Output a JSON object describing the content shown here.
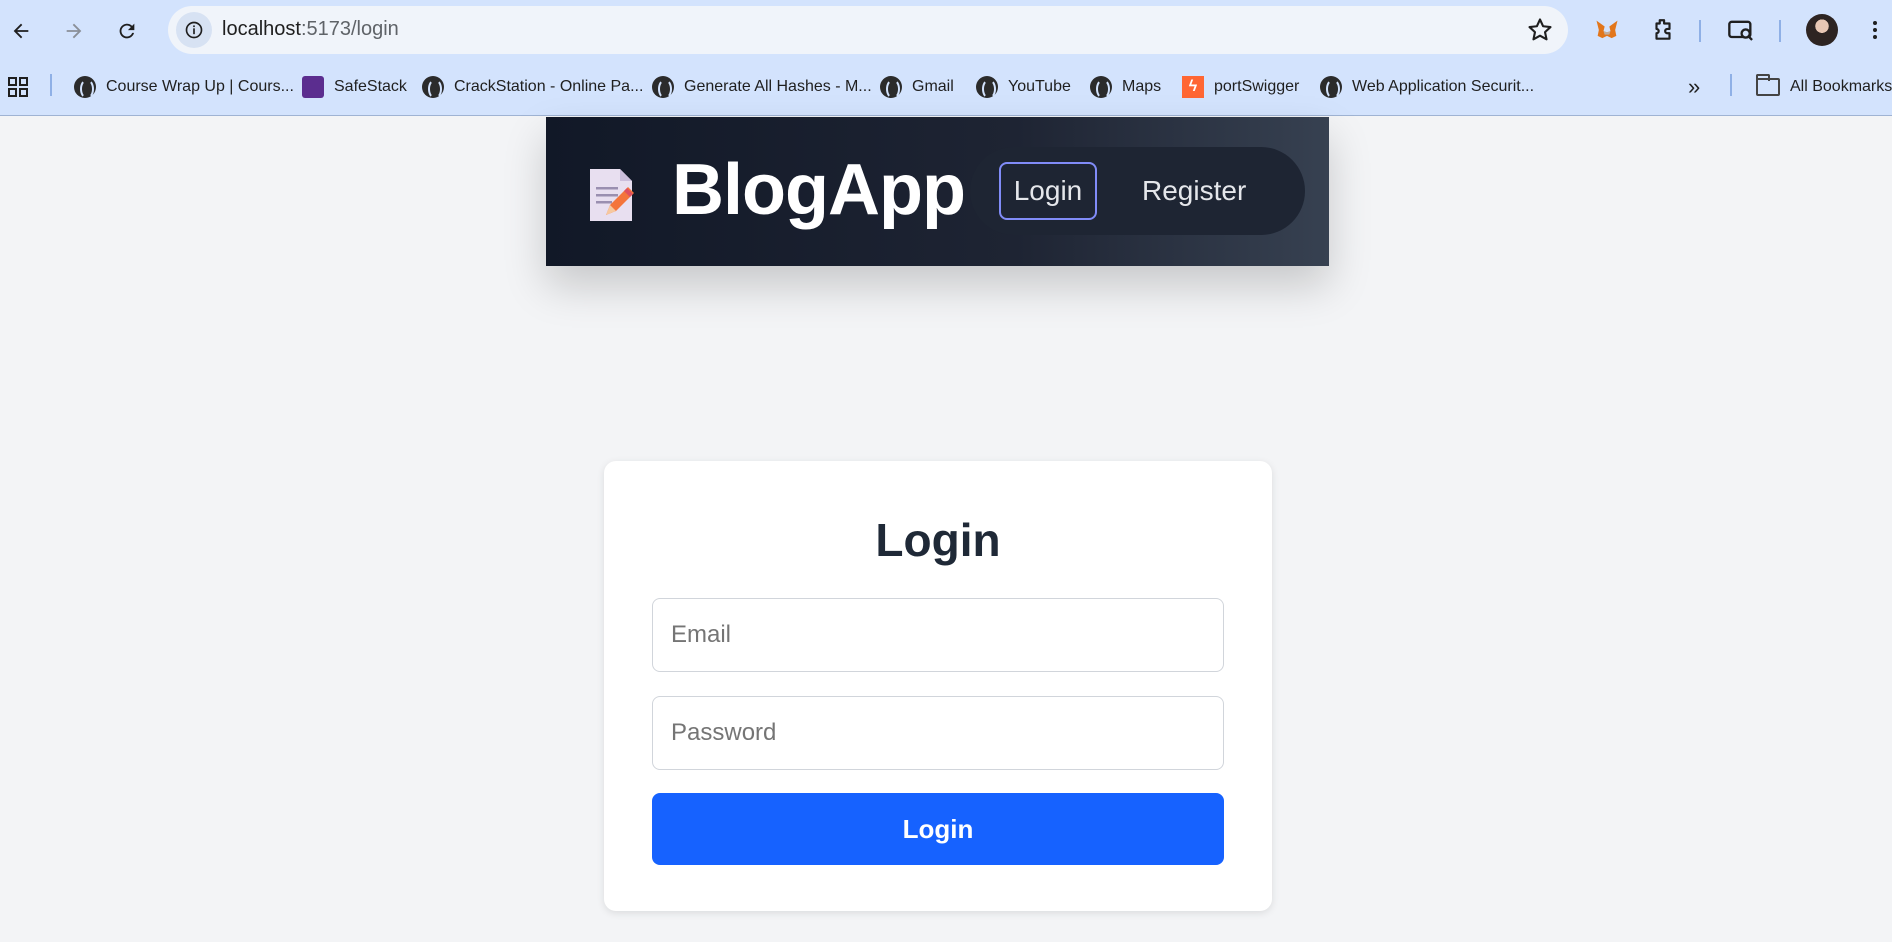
{
  "browser": {
    "url_host": "localhost",
    "url_path": ":5173/login",
    "bookmarks": [
      {
        "label": "Course Wrap Up | Cours...",
        "icon": "globe-icon"
      },
      {
        "label": "SafeStack",
        "icon": "safestack-icon"
      },
      {
        "label": "CrackStation - Online Pa...",
        "icon": "globe-icon"
      },
      {
        "label": "Generate All Hashes - M...",
        "icon": "globe-icon"
      },
      {
        "label": "Gmail",
        "icon": "globe-icon"
      },
      {
        "label": "YouTube",
        "icon": "globe-icon"
      },
      {
        "label": "Maps",
        "icon": "globe-icon"
      },
      {
        "label": "portSwigger",
        "icon": "portswigger-icon"
      },
      {
        "label": "Web Application Securit...",
        "icon": "globe-icon"
      }
    ],
    "all_bookmarks": "All Bookmarks",
    "overflow_glyph": "»"
  },
  "navbar": {
    "brand_icon": "memo-icon",
    "brand": "BlogApp",
    "login": "Login",
    "register": "Register"
  },
  "login_form": {
    "title": "Login",
    "email_placeholder": "Email",
    "password_placeholder": "Password",
    "submit": "Login"
  },
  "colors": {
    "navbar_start": "#111827",
    "navbar_end": "#374151",
    "primary_button": "#1662ff",
    "nav_active_border": "#818cf8",
    "page_background": "#f3f4f6"
  }
}
